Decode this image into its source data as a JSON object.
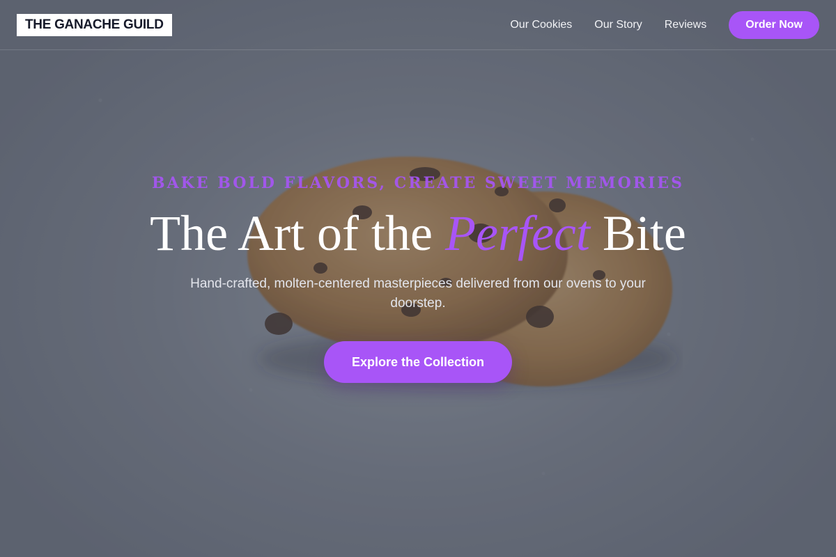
{
  "brand": {
    "logo_text": "THE GANACHE GUILD"
  },
  "nav": {
    "links": [
      {
        "label": "Our Cookies"
      },
      {
        "label": "Our Story"
      },
      {
        "label": "Reviews"
      }
    ],
    "order_button": "Order Now"
  },
  "hero": {
    "tagline": "BAKE BOLD FLAVORS, CREATE SWEET MEMORIES",
    "headline_before": "The Art of the ",
    "headline_accent": "Perfect",
    "headline_after": " Bite",
    "subtitle": "Hand-crafted, molten-centered masterpieces delivered from our ovens to your doorstep.",
    "cta_label": "Explore the Collection",
    "background_image": "cookie-photo"
  },
  "colors": {
    "accent": "#a855f7",
    "logo_bg": "#ffffff",
    "logo_text": "#161a2a",
    "overlay": "#464c5c"
  }
}
